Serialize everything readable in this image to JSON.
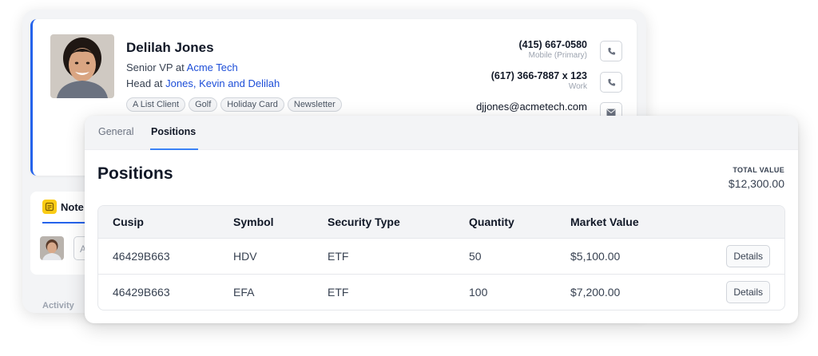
{
  "contact": {
    "name": "Delilah Jones",
    "title_prefix": "Senior VP at ",
    "title_company": "Acme Tech",
    "role_prefix": "Head at ",
    "role_org": "Jones, Kevin and Delilah",
    "tags": [
      "A List Client",
      "Golf",
      "Holiday Card",
      "Newsletter"
    ],
    "phones": [
      {
        "number": "(415) 667-0580",
        "label": "Mobile (Primary)"
      },
      {
        "number": "(617) 366-7887 x 123",
        "label": "Work"
      }
    ],
    "email": "djjones@acmetech.com"
  },
  "notes": {
    "tab_label": "Note",
    "input_placeholder": "A"
  },
  "activity": {
    "label": "Activity"
  },
  "positions": {
    "tabs": [
      {
        "label": "General",
        "active": false
      },
      {
        "label": "Positions",
        "active": true
      }
    ],
    "title": "Positions",
    "total_label": "TOTAL VALUE",
    "total_value": "$12,300.00",
    "columns": [
      "Cusip",
      "Symbol",
      "Security Type",
      "Quantity",
      "Market Value"
    ],
    "rows": [
      {
        "cusip": "46429B663",
        "symbol": "HDV",
        "type": "ETF",
        "quantity": "50",
        "market_value": "$5,100.00",
        "action": "Details"
      },
      {
        "cusip": "46429B663",
        "symbol": "EFA",
        "type": "ETF",
        "quantity": "100",
        "market_value": "$7,200.00",
        "action": "Details"
      }
    ]
  },
  "colors": {
    "accent": "#2563eb",
    "tab_underline": "#3b82f6",
    "link": "#1d4ed8",
    "note_icon": "#facc15"
  },
  "icons": {
    "phone": "phone-icon",
    "mail": "mail-icon",
    "note": "note-icon"
  }
}
